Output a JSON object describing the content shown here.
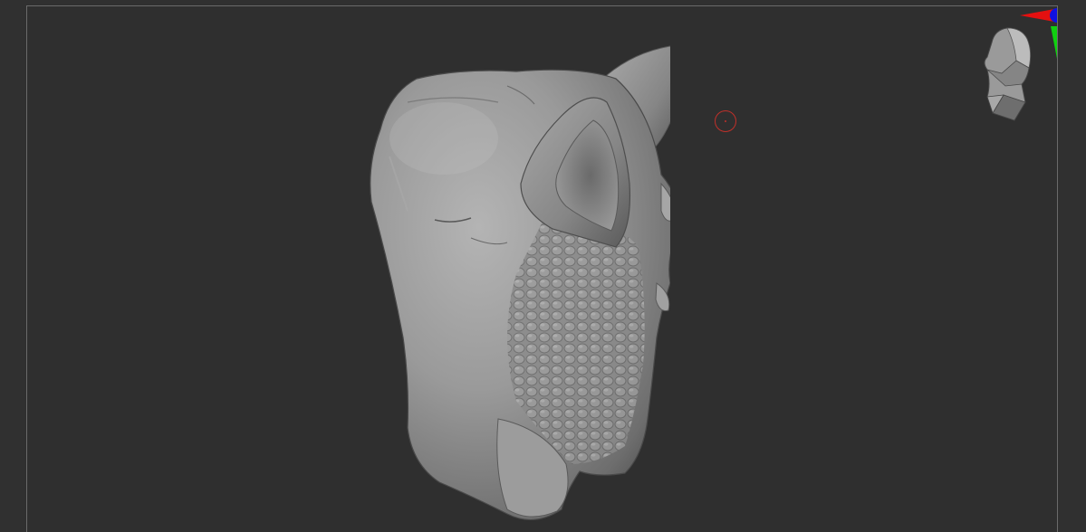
{
  "viewport": {
    "background_color": "#2f2f2f",
    "frame_color": "#6a6a6a",
    "model_color": "#8e8e8e"
  },
  "brush_cursor": {
    "icon": "circle-brush-cursor",
    "color": "#c0302a"
  },
  "orientation_gizmo": {
    "icon": "head-orientation-icon",
    "x_axis_color": "#e41010",
    "y_axis_color": "#10d010",
    "z_axis_color": "#1010e0"
  }
}
